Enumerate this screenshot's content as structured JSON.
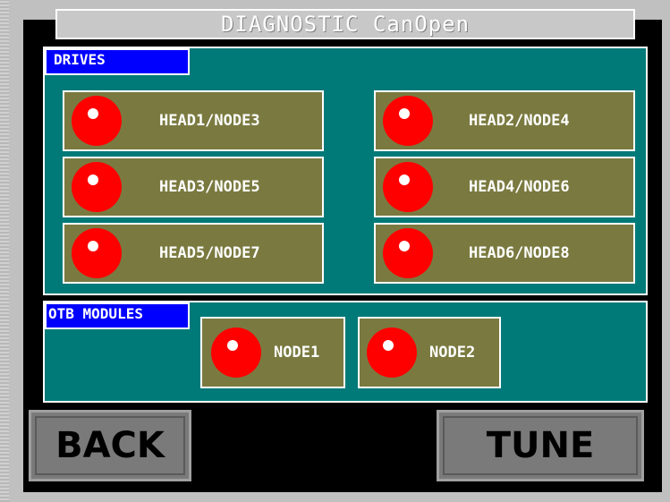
{
  "title": "DIAGNOSTIC CanOpen",
  "drives": {
    "label": "DRIVES",
    "nodes": [
      {
        "label": "HEAD1/NODE3",
        "status_color": "#ff0000"
      },
      {
        "label": "HEAD2/NODE4",
        "status_color": "#ff0000"
      },
      {
        "label": "HEAD3/NODE5",
        "status_color": "#ff0000"
      },
      {
        "label": "HEAD4/NODE6",
        "status_color": "#ff0000"
      },
      {
        "label": "HEAD5/NODE7",
        "status_color": "#ff0000"
      },
      {
        "label": "HEAD6/NODE8",
        "status_color": "#ff0000"
      }
    ]
  },
  "otb": {
    "label": "OTB MODULES",
    "nodes": [
      {
        "label": "NODE1",
        "status_color": "#ff0000"
      },
      {
        "label": "NODE2",
        "status_color": "#ff0000"
      }
    ]
  },
  "buttons": {
    "back": "BACK",
    "tune": "TUNE"
  },
  "colors": {
    "panel": "#007a78",
    "node_button": "#7a7a40",
    "label_bg": "#0000ff",
    "lamp_off": "#ff0000"
  }
}
